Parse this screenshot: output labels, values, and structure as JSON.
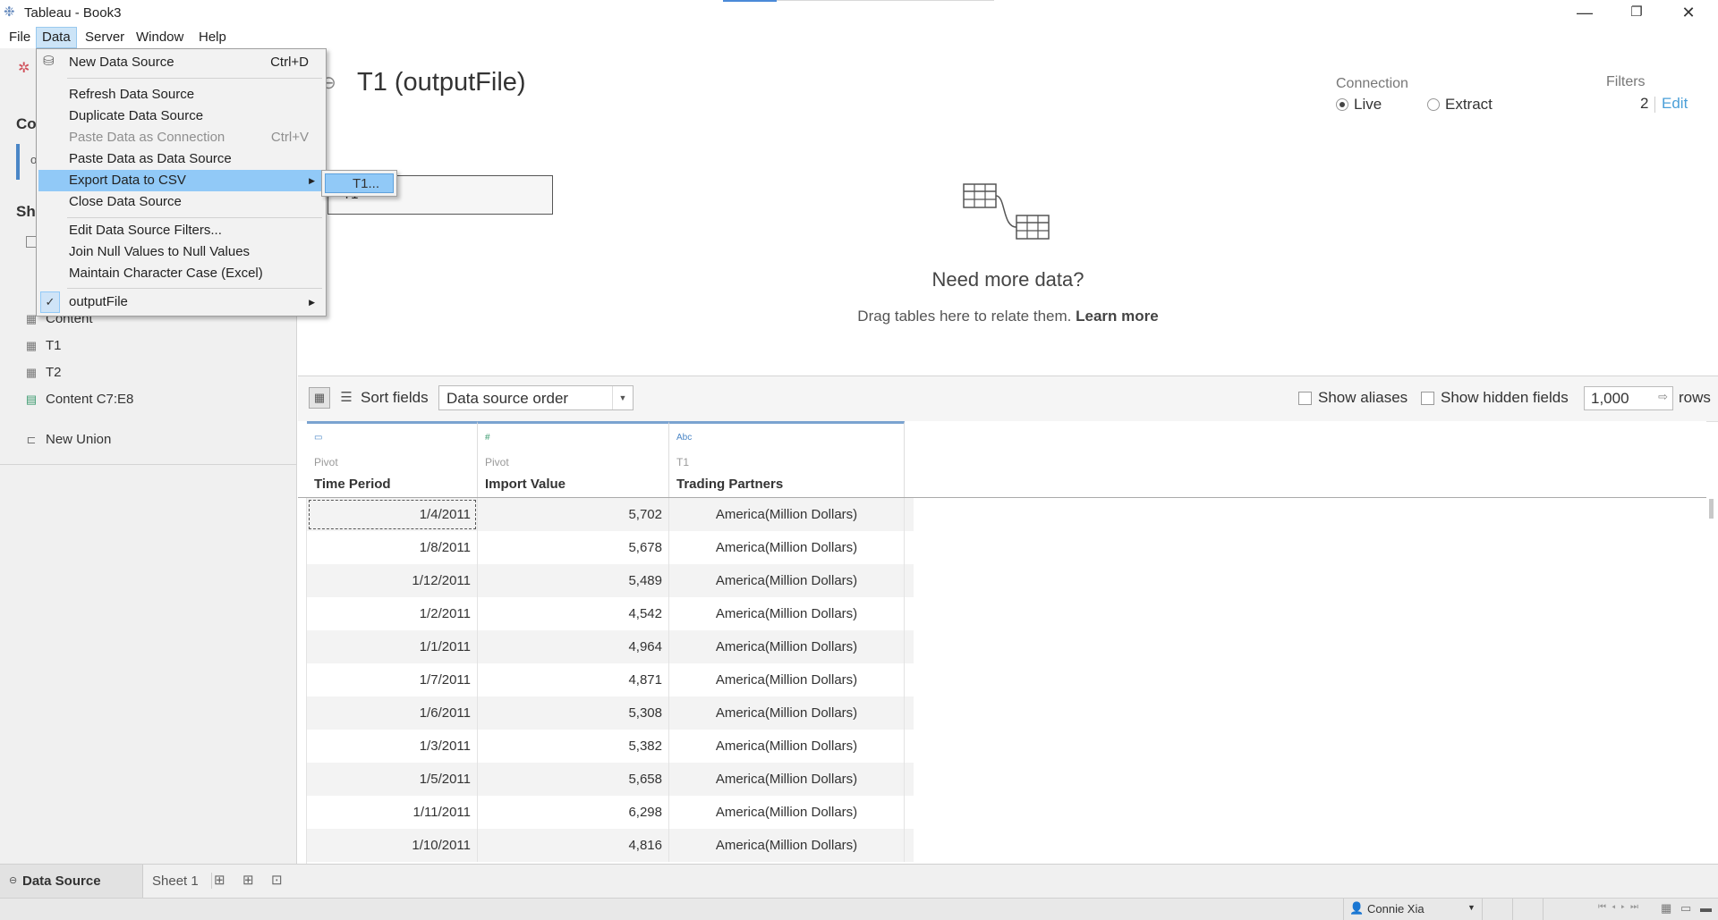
{
  "window": {
    "title": "Tableau - Book3",
    "minimize": "—",
    "maximize": "❐",
    "close": "✕"
  },
  "menubar": {
    "items": [
      "File",
      "Data",
      "Server",
      "Window",
      "Help"
    ]
  },
  "data_menu": {
    "items": [
      {
        "label": "New Data Source",
        "shortcut": "Ctrl+D"
      },
      {
        "label": "Refresh Data Source"
      },
      {
        "label": "Duplicate Data Source"
      },
      {
        "label": "Paste Data as Connection",
        "shortcut": "Ctrl+V",
        "disabled": true
      },
      {
        "label": "Paste Data as Data Source"
      },
      {
        "label": "Export Data to CSV",
        "submenu": true,
        "highlighted": true
      },
      {
        "label": "Close Data Source"
      },
      {
        "label": "Edit Data Source Filters..."
      },
      {
        "label": "Join Null Values to Null Values"
      },
      {
        "label": "Maintain Character Case (Excel)"
      },
      {
        "label": "outputFile",
        "checked": true,
        "submenu": true
      }
    ],
    "export_submenu_item": "T1..."
  },
  "left_panel": {
    "connections_heading": "Co",
    "connection_item": "o",
    "sheets_heading": "Sh",
    "tables": [
      "Content",
      "T1",
      "T2"
    ],
    "named_range": "Content C7:E8",
    "new_union": "New Union"
  },
  "canvas": {
    "datasource_title": "T1 (outputFile)",
    "table_box_label": "T1",
    "connection_label": "Connection",
    "live_label": "Live",
    "extract_label": "Extract",
    "connection_mode": "Live",
    "filters_label": "Filters",
    "filters_count": "2",
    "filters_edit": "Edit",
    "need_more_title": "Need more data?",
    "need_more_text": "Drag tables here to relate them.",
    "learn_more": "Learn more"
  },
  "grid_toolbar": {
    "sort_label": "Sort fields",
    "sort_value": "Data source order",
    "show_aliases": "Show aliases",
    "show_hidden": "Show hidden fields",
    "rows_value": "1,000",
    "rows_label": "rows"
  },
  "grid": {
    "columns": [
      {
        "type_icon": "▭",
        "source": "Pivot",
        "name": "Time Period"
      },
      {
        "type_icon": "#",
        "source": "Pivot",
        "name": "Import Value"
      },
      {
        "type_icon": "Abc",
        "source": "T1",
        "name": "Trading Partners"
      }
    ],
    "rows": [
      [
        "1/4/2011",
        "5,702",
        "America(Million Dollars)"
      ],
      [
        "1/8/2011",
        "5,678",
        "America(Million Dollars)"
      ],
      [
        "1/12/2011",
        "5,489",
        "America(Million Dollars)"
      ],
      [
        "1/2/2011",
        "4,542",
        "America(Million Dollars)"
      ],
      [
        "1/1/2011",
        "4,964",
        "America(Million Dollars)"
      ],
      [
        "1/7/2011",
        "4,871",
        "America(Million Dollars)"
      ],
      [
        "1/6/2011",
        "5,308",
        "America(Million Dollars)"
      ],
      [
        "1/3/2011",
        "5,382",
        "America(Million Dollars)"
      ],
      [
        "1/5/2011",
        "5,658",
        "America(Million Dollars)"
      ],
      [
        "1/11/2011",
        "6,298",
        "America(Million Dollars)"
      ],
      [
        "1/10/2011",
        "4,816",
        "America(Million Dollars)"
      ]
    ]
  },
  "tabs": {
    "data_source": "Data Source",
    "sheet1": "Sheet 1"
  },
  "status": {
    "user": "Connie Xia"
  },
  "colors": {
    "accent": "#4a86c6",
    "menu_highlight": "#91c9f7",
    "link": "#4a9fd8"
  }
}
